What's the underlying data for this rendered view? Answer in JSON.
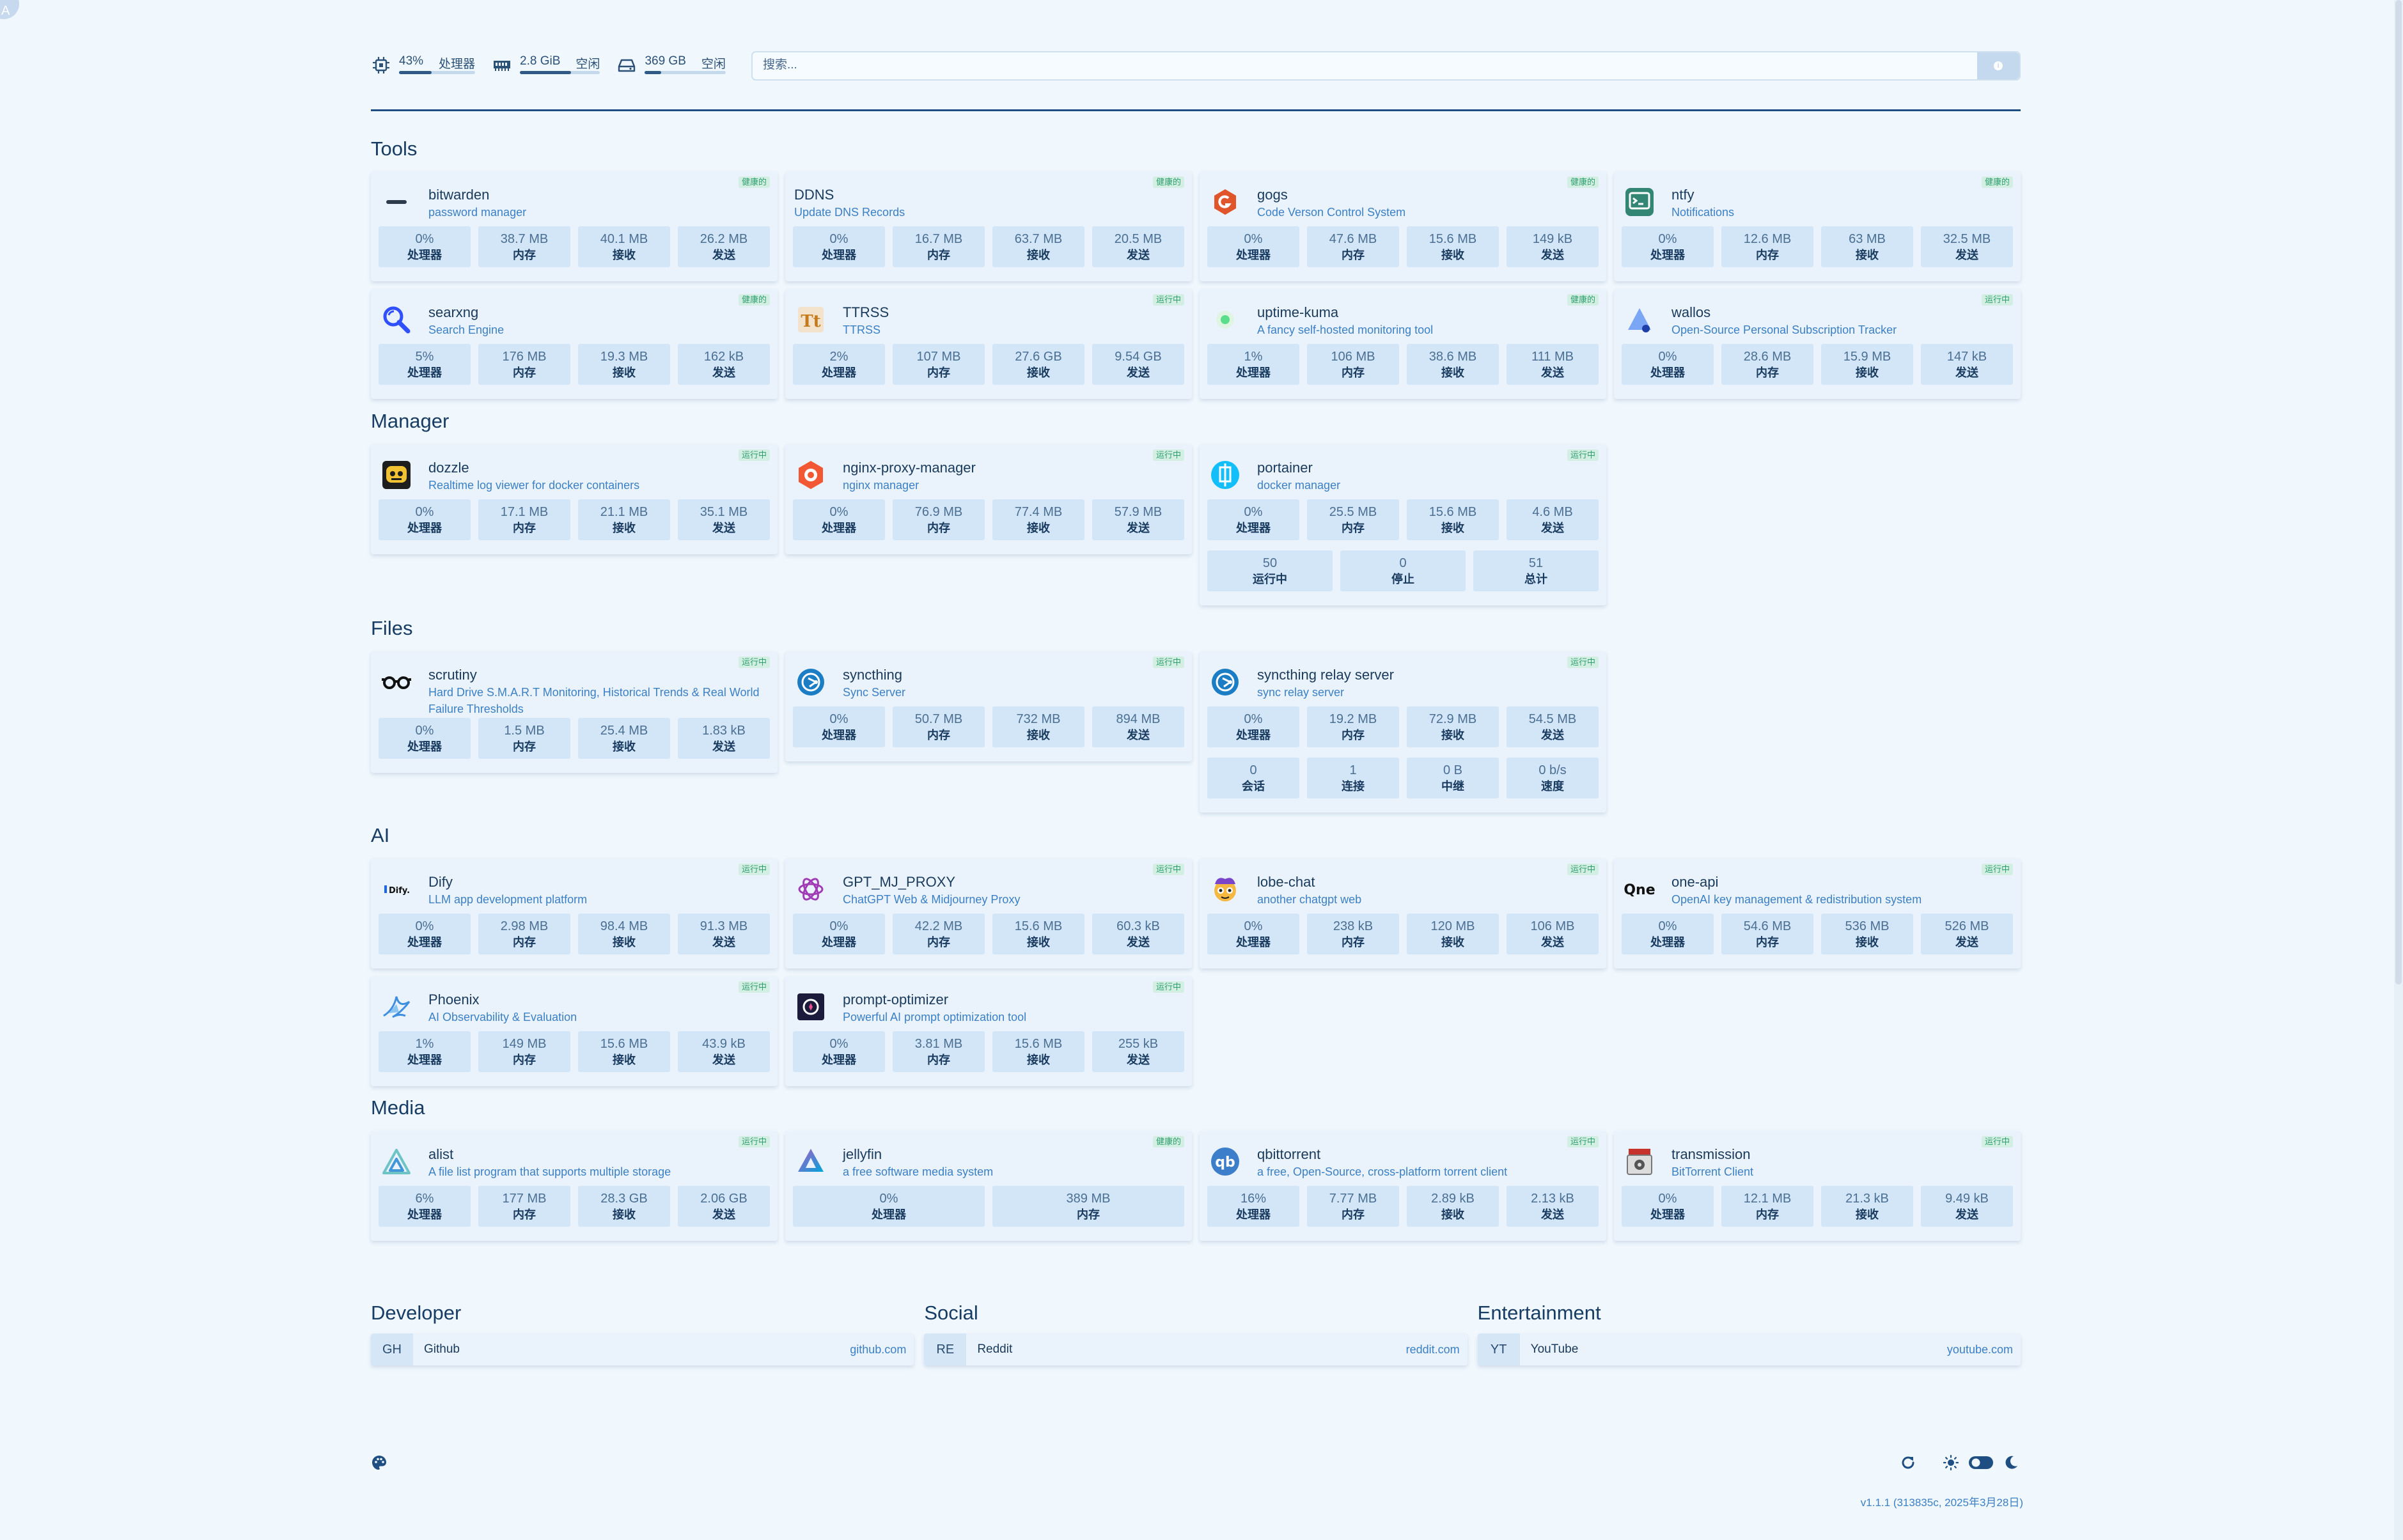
{
  "resources": {
    "cpu": {
      "value": "43%",
      "label": "处理器",
      "fill": 0.43
    },
    "mem": {
      "value": "2.8 GiB",
      "label": "空闲",
      "fill": 0.64
    },
    "disk": {
      "value": "369 GB",
      "label": "空闲",
      "fill": 0.2
    }
  },
  "search": {
    "placeholder": "搜索..."
  },
  "labels": {
    "cpu": "处理器",
    "mem": "内存",
    "rx": "接收",
    "tx": "发送"
  },
  "groups": {
    "tools": {
      "title": "Tools",
      "services": [
        {
          "name": "bitwarden",
          "desc": "password manager",
          "badge": "健康的",
          "stats": [
            "0%",
            "38.7 MB",
            "40.1 MB",
            "26.2 MB"
          ]
        },
        {
          "name": "DDNS",
          "desc": "Update DNS Records",
          "badge": "健康的",
          "stats": [
            "0%",
            "16.7 MB",
            "63.7 MB",
            "20.5 MB"
          ]
        },
        {
          "name": "gogs",
          "desc": "Code Verson Control System",
          "badge": "健康的",
          "stats": [
            "0%",
            "47.6 MB",
            "15.6 MB",
            "149 kB"
          ]
        },
        {
          "name": "ntfy",
          "desc": "Notifications",
          "badge": "健康的",
          "stats": [
            "0%",
            "12.6 MB",
            "63 MB",
            "32.5 MB"
          ]
        },
        {
          "name": "searxng",
          "desc": "Search Engine",
          "badge": "健康的",
          "stats": [
            "5%",
            "176 MB",
            "19.3 MB",
            "162 kB"
          ]
        },
        {
          "name": "TTRSS",
          "desc": "TTRSS",
          "badge": "运行中",
          "stats": [
            "2%",
            "107 MB",
            "27.6 GB",
            "9.54 GB"
          ]
        },
        {
          "name": "uptime-kuma",
          "desc": "A fancy self-hosted monitoring tool",
          "badge": "健康的",
          "stats": [
            "1%",
            "106 MB",
            "38.6 MB",
            "111 MB"
          ]
        },
        {
          "name": "wallos",
          "desc": "Open-Source Personal Subscription Tracker",
          "badge": "运行中",
          "stats": [
            "0%",
            "28.6 MB",
            "15.9 MB",
            "147 kB"
          ]
        }
      ]
    },
    "manager": {
      "title": "Manager",
      "services": [
        {
          "name": "dozzle",
          "desc": "Realtime log viewer for docker containers",
          "badge": "运行中",
          "stats": [
            "0%",
            "17.1 MB",
            "21.1 MB",
            "35.1 MB"
          ]
        },
        {
          "name": "nginx-proxy-manager",
          "desc": "nginx manager",
          "badge": "运行中",
          "stats": [
            "0%",
            "76.9 MB",
            "77.4 MB",
            "57.9 MB"
          ]
        },
        {
          "name": "portainer",
          "desc": "docker manager",
          "badge": "运行中",
          "stats": [
            "0%",
            "25.5 MB",
            "15.6 MB",
            "4.6 MB"
          ],
          "extra": [
            {
              "v": "50",
              "l": "运行中"
            },
            {
              "v": "0",
              "l": "停止"
            },
            {
              "v": "51",
              "l": "总计"
            }
          ]
        }
      ]
    },
    "files": {
      "title": "Files",
      "services": [
        {
          "name": "scrutiny",
          "desc": "Hard Drive S.M.A.R.T Monitoring, Historical Trends & Real World Failure Thresholds",
          "badge": "运行中",
          "stats": [
            "0%",
            "1.5 MB",
            "25.4 MB",
            "1.83 kB"
          ]
        },
        {
          "name": "syncthing",
          "desc": "Sync Server",
          "badge": "运行中",
          "stats": [
            "0%",
            "50.7 MB",
            "732 MB",
            "894 MB"
          ]
        },
        {
          "name": "syncthing relay server",
          "desc": "sync relay server",
          "badge": "运行中",
          "stats": [
            "0%",
            "19.2 MB",
            "72.9 MB",
            "54.5 MB"
          ],
          "extra": [
            {
              "v": "0",
              "l": "会话"
            },
            {
              "v": "1",
              "l": "连接"
            },
            {
              "v": "0 B",
              "l": "中继"
            },
            {
              "v": "0 b/s",
              "l": "速度"
            }
          ]
        }
      ]
    },
    "ai": {
      "title": "AI",
      "services": [
        {
          "name": "Dify",
          "desc": "LLM app development platform",
          "badge": "运行中",
          "stats": [
            "0%",
            "2.98 MB",
            "98.4 MB",
            "91.3 MB"
          ]
        },
        {
          "name": "GPT_MJ_PROXY",
          "desc": "ChatGPT Web & Midjourney Proxy",
          "badge": "运行中",
          "stats": [
            "0%",
            "42.2 MB",
            "15.6 MB",
            "60.3 kB"
          ]
        },
        {
          "name": "lobe-chat",
          "desc": "another chatgpt web",
          "badge": "运行中",
          "stats": [
            "0%",
            "238 kB",
            "120 MB",
            "106 MB"
          ]
        },
        {
          "name": "one-api",
          "desc": "OpenAI key management & redistribution system",
          "badge": "运行中",
          "stats": [
            "0%",
            "54.6 MB",
            "536 MB",
            "526 MB"
          ]
        },
        {
          "name": "Phoenix",
          "desc": "AI Observability & Evaluation",
          "badge": "运行中",
          "stats": [
            "1%",
            "149 MB",
            "15.6 MB",
            "43.9 kB"
          ]
        },
        {
          "name": "prompt-optimizer",
          "desc": "Powerful AI prompt optimization tool",
          "badge": "运行中",
          "stats": [
            "0%",
            "3.81 MB",
            "15.6 MB",
            "255 kB"
          ]
        }
      ]
    },
    "media": {
      "title": "Media",
      "services": [
        {
          "name": "alist",
          "desc": "A file list program that supports multiple storage",
          "badge": "运行中",
          "stats": [
            "6%",
            "177 MB",
            "28.3 GB",
            "2.06 GB"
          ]
        },
        {
          "name": "jellyfin",
          "desc": "a free software media system",
          "badge": "健康的",
          "stats": [
            "0%",
            "389 MB"
          ]
        },
        {
          "name": "qbittorrent",
          "desc": "a free, Open-Source, cross-platform torrent client",
          "badge": "运行中",
          "stats": [
            "16%",
            "7.77 MB",
            "2.89 kB",
            "2.13 kB"
          ]
        },
        {
          "name": "transmission",
          "desc": "BitTorrent Client",
          "badge": "运行中",
          "stats": [
            "0%",
            "12.1 MB",
            "21.3 kB",
            "9.49 kB"
          ]
        }
      ]
    }
  },
  "bookmarks": [
    {
      "group": "Developer",
      "abbr": "GH",
      "name": "Github",
      "url": "github.com"
    },
    {
      "group": "Social",
      "abbr": "RE",
      "name": "Reddit",
      "url": "reddit.com"
    },
    {
      "group": "Entertainment",
      "abbr": "YT",
      "name": "YouTube",
      "url": "youtube.com"
    }
  ],
  "footer": {
    "version": "v1.1.1 (313835c, 2025年3月28日)"
  },
  "corner_letter": "A",
  "colors": {
    "accent": "#1f4f82",
    "background": "#f0f7fd",
    "badge_green": "#2f9e6e",
    "link": "#3b80c5"
  },
  "icons": [
    "cpu-icon",
    "memory-icon",
    "disk-icon",
    "palette-icon",
    "refresh-icon",
    "sun-icon",
    "toggle-icon",
    "moon-icon"
  ]
}
